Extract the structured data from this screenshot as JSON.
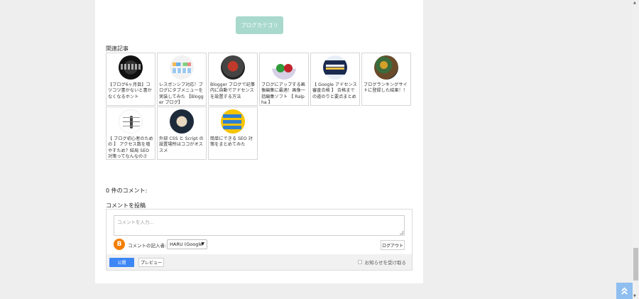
{
  "category_button": {
    "label": "ブログカテゴリ"
  },
  "related": {
    "title": "関連記事",
    "posts": [
      {
        "title": "【ブログ6ヶ月目】コツコツ書かないと書かなくなるホント"
      },
      {
        "title": "レスポンシブ対応！ブログにタブメニューを実装してみた 【Blogger ブログ】"
      },
      {
        "title": "Blogger ブログで記事内に自動でアドセンスを設置する方法"
      },
      {
        "title": "ブログにアップする画像編集に最適！画像一括編集ソフト 【 Ralpha 】"
      },
      {
        "title": "【 Google アドセンス審査合格 】 合格までの道のりと要点まとめ"
      },
      {
        "title": "ブログランキングサイトに登録した結果！！"
      },
      {
        "title": "【 ブログ初心者のための 】 アクセス数を増やすため？結局 SEO 対策ってなんなのさ"
      },
      {
        "title": "外部 CSS と Script の設置場所はココがオススメ"
      },
      {
        "title": "簡単にできる SEO 対策をまとめてみた"
      }
    ]
  },
  "comments": {
    "count_text": "0 件のコメント:",
    "post_heading": "コメントを投稿",
    "textarea_placeholder": "コメントを入力...",
    "writer_label": "コメントの記入者:",
    "writer_value": "HARU (Google",
    "logout_label": "ログアウト",
    "publish_label": "公開",
    "preview_label": "プレビュー",
    "notify_label": "お知らせを受け取る"
  },
  "icons": {
    "blogger": "blogger-icon",
    "back_to_top": "double-chevron-up-icon"
  },
  "colors": {
    "category_button": "#a8d9cc",
    "publish_button": "#3e86f5",
    "back_to_top": "#8fbef0",
    "blogger": "#f57d00"
  }
}
